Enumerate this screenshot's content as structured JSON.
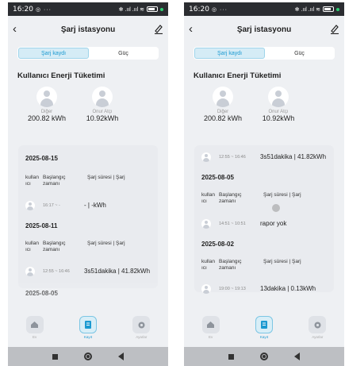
{
  "status": {
    "time": "16:20",
    "left_icons": "◎ ···",
    "right_icons": "✻ .ııl .ııl ≋"
  },
  "header": {
    "title": "Şarj istasyonu"
  },
  "tabs": [
    "Şarj kaydı",
    "Güç"
  ],
  "section_title": "Kullanıcı Enerji Tüketimi",
  "users": [
    {
      "name": "Diğer",
      "value": "200.82 kWh"
    },
    {
      "name": "Onur Atçı",
      "value": "10.92kWh"
    }
  ],
  "record_header": {
    "col1": "kullan ıcı",
    "col2": "Başlangıç zamanı",
    "col3": "Şarj süresi | Şarj"
  },
  "left_records": [
    {
      "date": "2025-08-15",
      "time": "16:17 ~ -",
      "value": "- | -kWh"
    },
    {
      "date": "2025-08-11",
      "time": "12:55 ~ 16:46",
      "value": "3s51dakika | 41.82kWh"
    },
    {
      "date": "2025-08-05"
    }
  ],
  "right_records": [
    {
      "time": "12:55 ~ 16:46",
      "value": "3s51dakika | 41.82kWh"
    },
    {
      "date": "2025-08-05",
      "time": "14:51 ~ 10:51",
      "value": "rapor yok"
    },
    {
      "date": "2025-08-02",
      "time": "19:00 ~ 19:13",
      "value": "13dakika | 0.13kWh"
    }
  ],
  "bottom_nav": [
    {
      "label": "Ev",
      "icon": "home-icon"
    },
    {
      "label": "Kayıt",
      "icon": "record-icon"
    },
    {
      "label": "Ayarlar",
      "icon": "settings-icon"
    }
  ],
  "colors": {
    "accent": "#1c9ad1",
    "background": "#eef0f3",
    "statusbar": "#2b2d31"
  }
}
